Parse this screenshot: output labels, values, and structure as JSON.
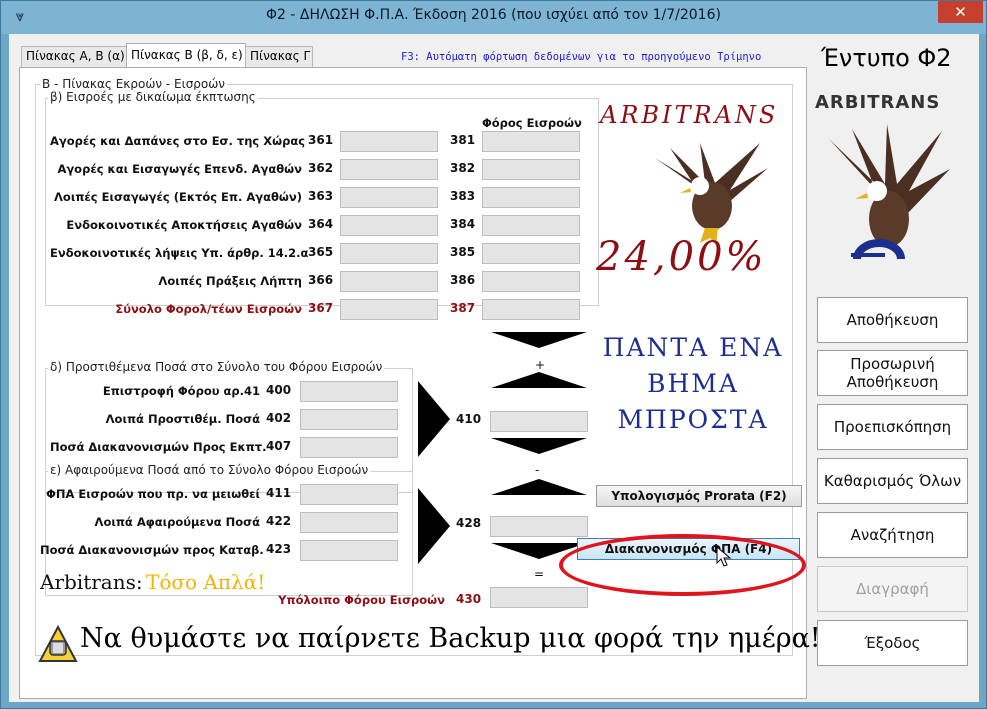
{
  "window": {
    "title": "Φ2 - ΔΗΛΩΣΗ Φ.Π.Α. Έκδοση 2016 (που ισχύει από τον 1/7/2016)",
    "close_glyph": "✕"
  },
  "tabs": [
    {
      "label": "Πίνακας Α, Β (α)",
      "active": false
    },
    {
      "label": "Πίνακας Β (β, δ, ε)",
      "active": true
    },
    {
      "label": "Πίνακας Γ",
      "active": false
    }
  ],
  "f3_hint": "F3: Αυτόματη φόρτωση δεδομένων για το προηγούμενο Τρίμηνο",
  "panel": {
    "title": "Β - Πίνακας Εκροών - Εισροών",
    "section_b": {
      "title": "β) Εισροές με δικαίωμα έκπτωσης",
      "tax_column_header": "Φόρος Εισροών",
      "rows": [
        {
          "label": "Αγορές και Δαπάνες στο Εσ. της Χώρας",
          "code": "361",
          "tax_code": "381"
        },
        {
          "label": "Αγορές και Εισαγωγές Επενδ. Αγαθών",
          "code": "362",
          "tax_code": "382"
        },
        {
          "label": "Λοιπές Εισαγωγές (Εκτός Επ. Αγαθών)",
          "code": "363",
          "tax_code": "383"
        },
        {
          "label": "Ενδοκοινοτικές Αποκτήσεις Αγαθών",
          "code": "364",
          "tax_code": "384"
        },
        {
          "label": "Ενδοκοινοτικές λήψεις Υπ. άρθρ. 14.2.α",
          "code": "365",
          "tax_code": "385"
        },
        {
          "label": "Λοιπές Πράξεις Λήπτη",
          "code": "366",
          "tax_code": "386"
        },
        {
          "label": "Σύνολο Φορολ/τέων Εισροών",
          "code": "367",
          "tax_code": "387"
        }
      ]
    },
    "section_d": {
      "title": "δ) Προστιθέμενα Ποσά στο Σύνολο του Φόρου Εισροών",
      "rows": [
        {
          "label": "Επιστροφή Φόρου αρ.41",
          "code": "400"
        },
        {
          "label": "Λοιπά Προστιθέμ. Ποσά",
          "code": "402"
        },
        {
          "label": "Ποσά Διακανονισμών Προς Εκπτ.",
          "code": "407"
        }
      ],
      "total_code": "410"
    },
    "section_e": {
      "title": "ε) Αφαιρούμενα Ποσά από το Σύνολο Φόρου Εισροών",
      "rows": [
        {
          "label": "ΦΠΑ Εισροών που πρ. να μειωθεί",
          "code": "411"
        },
        {
          "label": "Λοιπά Αφαιρούμενα Ποσά",
          "code": "422"
        },
        {
          "label": "Ποσά Διακανονισμών προς Καταβ.",
          "code": "423"
        }
      ],
      "total_code": "428"
    },
    "operators": {
      "plus": "+",
      "minus": "-",
      "equals": "="
    },
    "remaining": {
      "label": "Υπόλοιπο Φόρου Εισροών",
      "code": "430"
    },
    "buttons": {
      "prorata": "Υπολογισμός Prorata (F2)",
      "settlement": "Διακανονισμός ΦΠΑ (F4)"
    },
    "logo": {
      "brand": "ARBITRANS",
      "rate": "24,00%"
    },
    "slogan": [
      "ΠΑΝΤΑ ΕΝΑ",
      "ΒΗΜΑ",
      "ΜΠΡΟΣΤΑ"
    ],
    "tagline": {
      "brand": "Arbitrans:",
      "text": "Τόσο Απλά!"
    },
    "backup_reminder": "Να θυμάστε να παίρνετε Backup μια φορά την ημέρα!"
  },
  "sidebar": {
    "form_title": "Έντυπο Φ2",
    "brand": "ARBITRANS",
    "buttons": [
      {
        "label": "Αποθήκευση",
        "enabled": true
      },
      {
        "label": "Προσωρινή Αποθήκευση",
        "enabled": true
      },
      {
        "label": "Προεπισκόπηση",
        "enabled": true
      },
      {
        "label": "Καθαρισμός Όλων",
        "enabled": true
      },
      {
        "label": "Αναζήτηση",
        "enabled": true
      },
      {
        "label": "Διαγραφή",
        "enabled": false
      },
      {
        "label": "Έξοδος",
        "enabled": true
      }
    ]
  },
  "colors": {
    "accent_red": "#8b0f14",
    "highlight_red": "#e0141c",
    "slogan_blue": "#1d2f8e",
    "tagline_yellow": "#f0b400"
  },
  "icons": {
    "app": "eagle-icon",
    "warning": "warning-icon",
    "close": "close-icon"
  }
}
